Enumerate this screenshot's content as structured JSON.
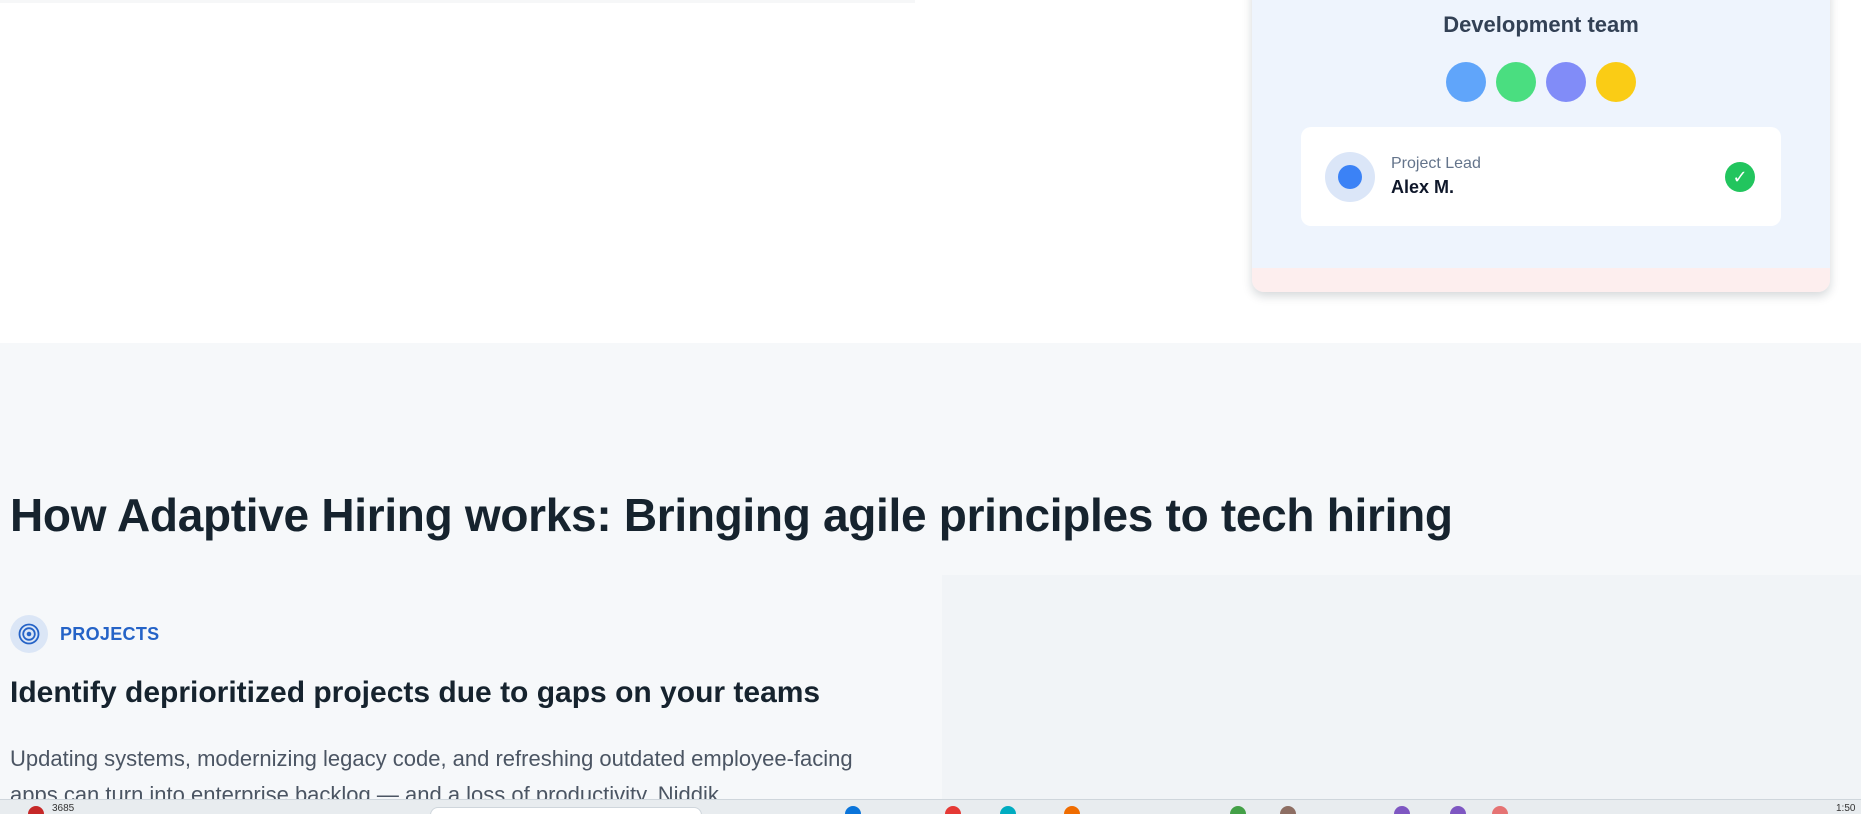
{
  "team_card": {
    "title": "Development team",
    "avatar_colors": [
      "#60a5fa",
      "#4ade80",
      "#818cf8",
      "#facc15"
    ],
    "lead": {
      "role": "Project Lead",
      "name": "Alex M.",
      "check": "✓"
    }
  },
  "section": {
    "heading": "How Adaptive Hiring works: Bringing agile principles to tech hiring",
    "tag_label": "PROJECTS",
    "tag_icon": "target-icon",
    "subheading": "Identify deprioritized projects due to gaps on your teams",
    "body": "Updating systems, modernizing legacy code, and refreshing outdated employee-facing apps can turn into enterprise backlog — and a loss of productivity. Niddik"
  },
  "taskbar": {
    "left_text": "3685",
    "right_text": "1:50"
  },
  "colors": {
    "accent": "#2563c7",
    "check_green": "#22c55e",
    "lead_avatar": "#3b82f6"
  }
}
